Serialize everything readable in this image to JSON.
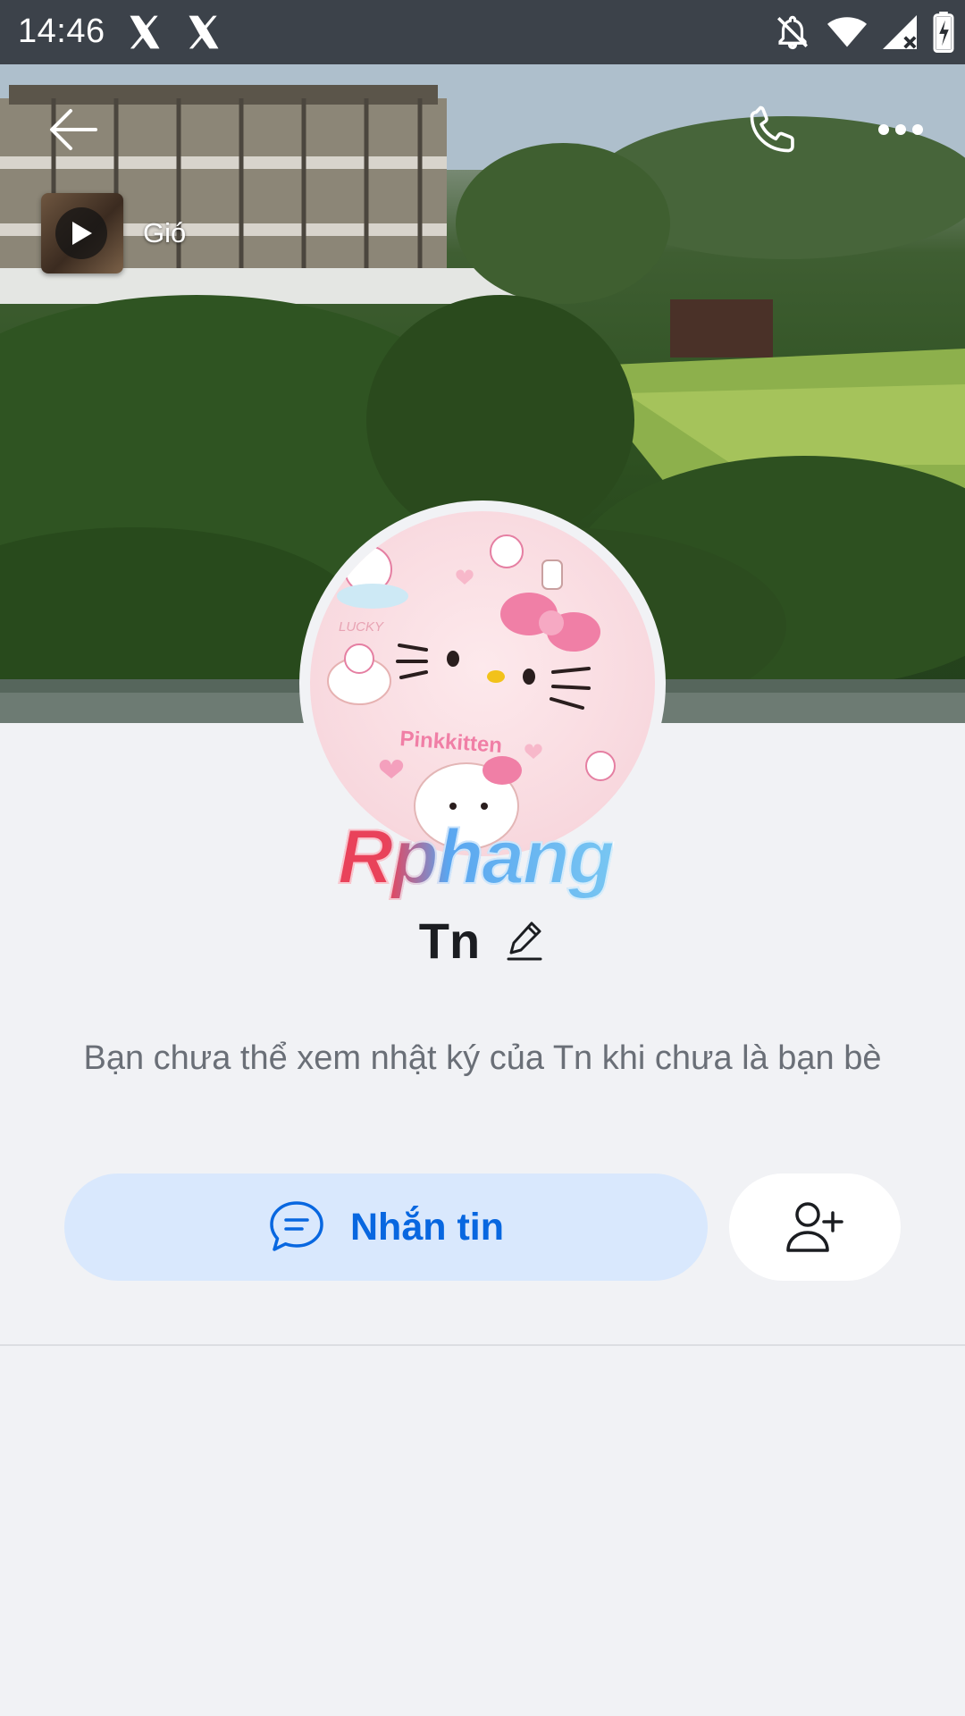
{
  "status_bar": {
    "time": "14:46",
    "notification_icons": [
      "x-logo-icon",
      "x-logo-icon"
    ],
    "system_icons": [
      "notifications-off-icon",
      "wifi-icon",
      "signal-icon",
      "battery-charging-icon"
    ]
  },
  "cover": {
    "music": {
      "title": "Gió"
    }
  },
  "profile": {
    "name": "Tn",
    "watermark": "Rphang",
    "notice": "Bạn chưa thể xem nhật ký của Tn khi chưa là bạn bè"
  },
  "actions": {
    "message_label": "Nhắn tin"
  },
  "colors": {
    "accent": "#0867e0",
    "message_button_bg": "#d9e8fd",
    "page_bg": "#f1f2f5"
  }
}
